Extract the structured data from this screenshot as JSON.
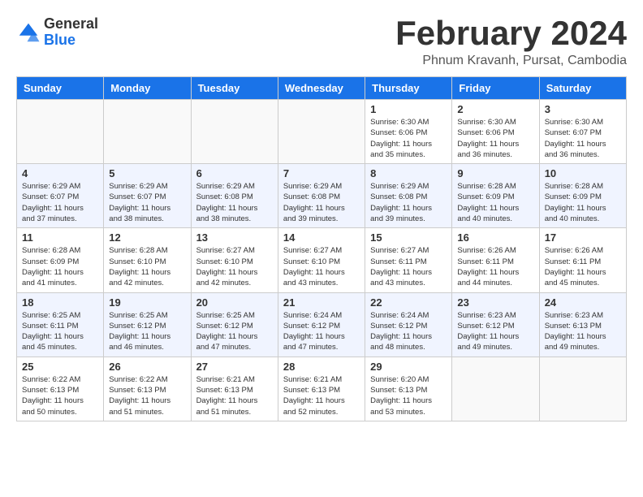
{
  "header": {
    "logo_general": "General",
    "logo_blue": "Blue",
    "month_title": "February 2024",
    "location": "Phnum Kravanh, Pursat, Cambodia"
  },
  "days_of_week": [
    "Sunday",
    "Monday",
    "Tuesday",
    "Wednesday",
    "Thursday",
    "Friday",
    "Saturday"
  ],
  "weeks": [
    [
      {
        "day": "",
        "info": ""
      },
      {
        "day": "",
        "info": ""
      },
      {
        "day": "",
        "info": ""
      },
      {
        "day": "",
        "info": ""
      },
      {
        "day": "1",
        "info": "Sunrise: 6:30 AM\nSunset: 6:06 PM\nDaylight: 11 hours\nand 35 minutes."
      },
      {
        "day": "2",
        "info": "Sunrise: 6:30 AM\nSunset: 6:06 PM\nDaylight: 11 hours\nand 36 minutes."
      },
      {
        "day": "3",
        "info": "Sunrise: 6:30 AM\nSunset: 6:07 PM\nDaylight: 11 hours\nand 36 minutes."
      }
    ],
    [
      {
        "day": "4",
        "info": "Sunrise: 6:29 AM\nSunset: 6:07 PM\nDaylight: 11 hours\nand 37 minutes."
      },
      {
        "day": "5",
        "info": "Sunrise: 6:29 AM\nSunset: 6:07 PM\nDaylight: 11 hours\nand 38 minutes."
      },
      {
        "day": "6",
        "info": "Sunrise: 6:29 AM\nSunset: 6:08 PM\nDaylight: 11 hours\nand 38 minutes."
      },
      {
        "day": "7",
        "info": "Sunrise: 6:29 AM\nSunset: 6:08 PM\nDaylight: 11 hours\nand 39 minutes."
      },
      {
        "day": "8",
        "info": "Sunrise: 6:29 AM\nSunset: 6:08 PM\nDaylight: 11 hours\nand 39 minutes."
      },
      {
        "day": "9",
        "info": "Sunrise: 6:28 AM\nSunset: 6:09 PM\nDaylight: 11 hours\nand 40 minutes."
      },
      {
        "day": "10",
        "info": "Sunrise: 6:28 AM\nSunset: 6:09 PM\nDaylight: 11 hours\nand 40 minutes."
      }
    ],
    [
      {
        "day": "11",
        "info": "Sunrise: 6:28 AM\nSunset: 6:09 PM\nDaylight: 11 hours\nand 41 minutes."
      },
      {
        "day": "12",
        "info": "Sunrise: 6:28 AM\nSunset: 6:10 PM\nDaylight: 11 hours\nand 42 minutes."
      },
      {
        "day": "13",
        "info": "Sunrise: 6:27 AM\nSunset: 6:10 PM\nDaylight: 11 hours\nand 42 minutes."
      },
      {
        "day": "14",
        "info": "Sunrise: 6:27 AM\nSunset: 6:10 PM\nDaylight: 11 hours\nand 43 minutes."
      },
      {
        "day": "15",
        "info": "Sunrise: 6:27 AM\nSunset: 6:11 PM\nDaylight: 11 hours\nand 43 minutes."
      },
      {
        "day": "16",
        "info": "Sunrise: 6:26 AM\nSunset: 6:11 PM\nDaylight: 11 hours\nand 44 minutes."
      },
      {
        "day": "17",
        "info": "Sunrise: 6:26 AM\nSunset: 6:11 PM\nDaylight: 11 hours\nand 45 minutes."
      }
    ],
    [
      {
        "day": "18",
        "info": "Sunrise: 6:25 AM\nSunset: 6:11 PM\nDaylight: 11 hours\nand 45 minutes."
      },
      {
        "day": "19",
        "info": "Sunrise: 6:25 AM\nSunset: 6:12 PM\nDaylight: 11 hours\nand 46 minutes."
      },
      {
        "day": "20",
        "info": "Sunrise: 6:25 AM\nSunset: 6:12 PM\nDaylight: 11 hours\nand 47 minutes."
      },
      {
        "day": "21",
        "info": "Sunrise: 6:24 AM\nSunset: 6:12 PM\nDaylight: 11 hours\nand 47 minutes."
      },
      {
        "day": "22",
        "info": "Sunrise: 6:24 AM\nSunset: 6:12 PM\nDaylight: 11 hours\nand 48 minutes."
      },
      {
        "day": "23",
        "info": "Sunrise: 6:23 AM\nSunset: 6:12 PM\nDaylight: 11 hours\nand 49 minutes."
      },
      {
        "day": "24",
        "info": "Sunrise: 6:23 AM\nSunset: 6:13 PM\nDaylight: 11 hours\nand 49 minutes."
      }
    ],
    [
      {
        "day": "25",
        "info": "Sunrise: 6:22 AM\nSunset: 6:13 PM\nDaylight: 11 hours\nand 50 minutes."
      },
      {
        "day": "26",
        "info": "Sunrise: 6:22 AM\nSunset: 6:13 PM\nDaylight: 11 hours\nand 51 minutes."
      },
      {
        "day": "27",
        "info": "Sunrise: 6:21 AM\nSunset: 6:13 PM\nDaylight: 11 hours\nand 51 minutes."
      },
      {
        "day": "28",
        "info": "Sunrise: 6:21 AM\nSunset: 6:13 PM\nDaylight: 11 hours\nand 52 minutes."
      },
      {
        "day": "29",
        "info": "Sunrise: 6:20 AM\nSunset: 6:13 PM\nDaylight: 11 hours\nand 53 minutes."
      },
      {
        "day": "",
        "info": ""
      },
      {
        "day": "",
        "info": ""
      }
    ]
  ]
}
